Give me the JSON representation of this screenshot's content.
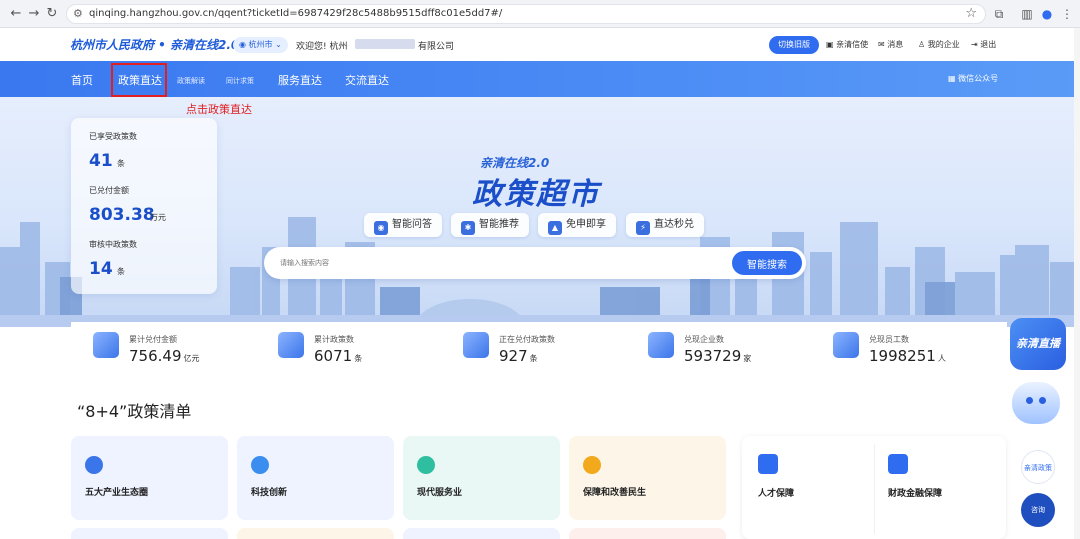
{
  "browser": {
    "url": "qinqing.hangzhou.gov.cn/qqent?ticketId=6987429f28c5488b9515dff8c01e5dd7#/"
  },
  "site": {
    "logo": "杭州市人民政府 • 亲清在线2.0",
    "city": "杭州市",
    "welcome": "欢迎您! 杭州",
    "company_suffix": "有限公司",
    "switch_label": "切换旧版",
    "links": [
      "亲清信使",
      "消息",
      "我的企业",
      "退出"
    ]
  },
  "nav": {
    "items": [
      "首页",
      "政策直达",
      "政策解读",
      "同计求策",
      "服务直达",
      "交流直达"
    ],
    "wechat": "微信公众号",
    "hint": "点击政策直达"
  },
  "hero": {
    "tag": "亲清在线2.0",
    "title": "政策超市",
    "chips": [
      "智能问答",
      "智能推荐",
      "免申即享",
      "直达秒兑"
    ],
    "search_placeholder": "请输入搜索内容",
    "search_button": "智能搜索"
  },
  "left_card": {
    "items": [
      {
        "label": "已享受政策数",
        "value": "41",
        "unit": "条"
      },
      {
        "label": "已兑付金额",
        "value": "803.38",
        "unit": "万元"
      },
      {
        "label": "审核中政策数",
        "value": "14",
        "unit": "条"
      }
    ]
  },
  "stats": [
    {
      "label": "累计兑付金额",
      "value": "756.49",
      "unit": "亿元"
    },
    {
      "label": "累计政策数",
      "value": "6071",
      "unit": "条"
    },
    {
      "label": "正在兑付政策数",
      "value": "927",
      "unit": "条"
    },
    {
      "label": "兑现企业数",
      "value": "593729",
      "unit": "家"
    },
    {
      "label": "兑现员工数",
      "value": "1998251",
      "unit": "人"
    }
  ],
  "section": {
    "title": "“8+4”政策清单",
    "cards": [
      "五大产业生态圈",
      "科技创新",
      "现代服务业",
      "保障和改善民生"
    ],
    "right_cards": [
      "人才保障",
      "财政金融保障"
    ]
  },
  "floating": {
    "live": "亲清直播",
    "feedback": "亲清政策",
    "consult": "咨询"
  },
  "colors": {
    "brand": "#2f6cf0",
    "highlight": "#e02020"
  }
}
